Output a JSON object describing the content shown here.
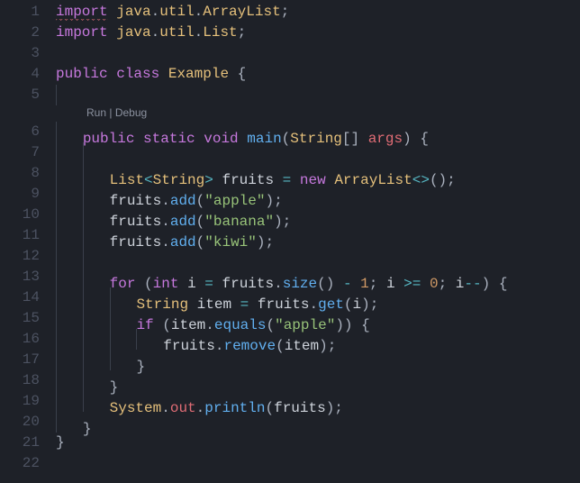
{
  "codelens": {
    "run": "Run",
    "debug": "Debug",
    "sep": " | "
  },
  "lines": [
    {
      "n": "1",
      "lead": "",
      "tokens": [
        [
          "kw squiggle",
          "import"
        ],
        [
          "ident",
          " "
        ],
        [
          "type",
          "java"
        ],
        [
          "punct",
          "."
        ],
        [
          "type",
          "util"
        ],
        [
          "punct",
          "."
        ],
        [
          "type",
          "ArrayList"
        ],
        [
          "punct",
          ";"
        ]
      ]
    },
    {
      "n": "2",
      "lead": "",
      "tokens": [
        [
          "kw",
          "import"
        ],
        [
          "ident",
          " "
        ],
        [
          "type",
          "java"
        ],
        [
          "punct",
          "."
        ],
        [
          "type",
          "util"
        ],
        [
          "punct",
          "."
        ],
        [
          "type",
          "List"
        ],
        [
          "punct",
          ";"
        ]
      ]
    },
    {
      "n": "3",
      "lead": "",
      "tokens": []
    },
    {
      "n": "4",
      "lead": "",
      "tokens": [
        [
          "kw",
          "public"
        ],
        [
          "ident",
          " "
        ],
        [
          "kw",
          "class"
        ],
        [
          "ident",
          " "
        ],
        [
          "type",
          "Example"
        ],
        [
          "ident",
          " "
        ],
        [
          "punct",
          "{"
        ]
      ]
    },
    {
      "n": "5",
      "lead": "g",
      "tokens": []
    },
    {
      "n": "6",
      "lead": "g",
      "tokens": [
        [
          "kw",
          "public"
        ],
        [
          "ident",
          " "
        ],
        [
          "kw",
          "static"
        ],
        [
          "ident",
          " "
        ],
        [
          "kw",
          "void"
        ],
        [
          "ident",
          " "
        ],
        [
          "fn",
          "main"
        ],
        [
          "punct",
          "("
        ],
        [
          "type",
          "String"
        ],
        [
          "punct",
          "[] "
        ],
        [
          "var",
          "args"
        ],
        [
          "punct",
          ") {"
        ]
      ]
    },
    {
      "n": "7",
      "lead": "gg",
      "tokens": []
    },
    {
      "n": "8",
      "lead": "gg",
      "tokens": [
        [
          "type",
          "List"
        ],
        [
          "op",
          "<"
        ],
        [
          "type",
          "String"
        ],
        [
          "op",
          ">"
        ],
        [
          "ident",
          " fruits "
        ],
        [
          "op",
          "="
        ],
        [
          "ident",
          " "
        ],
        [
          "kw",
          "new"
        ],
        [
          "ident",
          " "
        ],
        [
          "type",
          "ArrayList"
        ],
        [
          "op",
          "<>"
        ],
        [
          "punct",
          "();"
        ]
      ]
    },
    {
      "n": "9",
      "lead": "gg",
      "tokens": [
        [
          "ident",
          "fruits"
        ],
        [
          "punct",
          "."
        ],
        [
          "fn",
          "add"
        ],
        [
          "punct",
          "("
        ],
        [
          "str",
          "\"apple\""
        ],
        [
          "punct",
          ");"
        ]
      ]
    },
    {
      "n": "10",
      "lead": "gg",
      "tokens": [
        [
          "ident",
          "fruits"
        ],
        [
          "punct",
          "."
        ],
        [
          "fn",
          "add"
        ],
        [
          "punct",
          "("
        ],
        [
          "str",
          "\"banana\""
        ],
        [
          "punct",
          ");"
        ]
      ]
    },
    {
      "n": "11",
      "lead": "gg",
      "tokens": [
        [
          "ident",
          "fruits"
        ],
        [
          "punct",
          "."
        ],
        [
          "fn",
          "add"
        ],
        [
          "punct",
          "("
        ],
        [
          "str",
          "\"kiwi\""
        ],
        [
          "punct",
          ");"
        ]
      ]
    },
    {
      "n": "12",
      "lead": "gg",
      "tokens": []
    },
    {
      "n": "13",
      "lead": "gg",
      "tokens": [
        [
          "kw",
          "for"
        ],
        [
          "ident",
          " "
        ],
        [
          "punct",
          "("
        ],
        [
          "kw",
          "int"
        ],
        [
          "ident",
          " i "
        ],
        [
          "op",
          "="
        ],
        [
          "ident",
          " fruits"
        ],
        [
          "punct",
          "."
        ],
        [
          "fn",
          "size"
        ],
        [
          "punct",
          "() "
        ],
        [
          "op",
          "-"
        ],
        [
          "ident",
          " "
        ],
        [
          "num",
          "1"
        ],
        [
          "punct",
          "; "
        ],
        [
          "ident",
          "i "
        ],
        [
          "op",
          ">="
        ],
        [
          "ident",
          " "
        ],
        [
          "num",
          "0"
        ],
        [
          "punct",
          "; "
        ],
        [
          "ident",
          "i"
        ],
        [
          "op",
          "--"
        ],
        [
          "punct",
          ") {"
        ]
      ]
    },
    {
      "n": "14",
      "lead": "ggg",
      "tokens": [
        [
          "type",
          "String"
        ],
        [
          "ident",
          " item "
        ],
        [
          "op",
          "="
        ],
        [
          "ident",
          " fruits"
        ],
        [
          "punct",
          "."
        ],
        [
          "fn",
          "get"
        ],
        [
          "punct",
          "("
        ],
        [
          "ident",
          "i"
        ],
        [
          "punct",
          ");"
        ]
      ]
    },
    {
      "n": "15",
      "lead": "ggg",
      "tokens": [
        [
          "kw",
          "if"
        ],
        [
          "ident",
          " "
        ],
        [
          "punct",
          "("
        ],
        [
          "ident",
          "item"
        ],
        [
          "punct",
          "."
        ],
        [
          "fn",
          "equals"
        ],
        [
          "punct",
          "("
        ],
        [
          "str",
          "\"apple\""
        ],
        [
          "punct",
          ")) {"
        ]
      ]
    },
    {
      "n": "16",
      "lead": "gggg",
      "tokens": [
        [
          "ident",
          "fruits"
        ],
        [
          "punct",
          "."
        ],
        [
          "fn",
          "remove"
        ],
        [
          "punct",
          "("
        ],
        [
          "ident",
          "item"
        ],
        [
          "punct",
          ");"
        ]
      ]
    },
    {
      "n": "17",
      "lead": "ggg",
      "tokens": [
        [
          "punct",
          "}"
        ]
      ]
    },
    {
      "n": "18",
      "lead": "gg",
      "tokens": [
        [
          "punct",
          "}"
        ]
      ]
    },
    {
      "n": "19",
      "lead": "gg",
      "tokens": [
        [
          "type",
          "System"
        ],
        [
          "punct",
          "."
        ],
        [
          "var",
          "out"
        ],
        [
          "punct",
          "."
        ],
        [
          "fn",
          "println"
        ],
        [
          "punct",
          "("
        ],
        [
          "ident",
          "fruits"
        ],
        [
          "punct",
          ");"
        ]
      ]
    },
    {
      "n": "20",
      "lead": "g",
      "tokens": [
        [
          "punct",
          "}"
        ]
      ]
    },
    {
      "n": "21",
      "lead": "",
      "tokens": [
        [
          "punct",
          "}"
        ]
      ]
    },
    {
      "n": "22",
      "lead": "",
      "tokens": []
    }
  ]
}
